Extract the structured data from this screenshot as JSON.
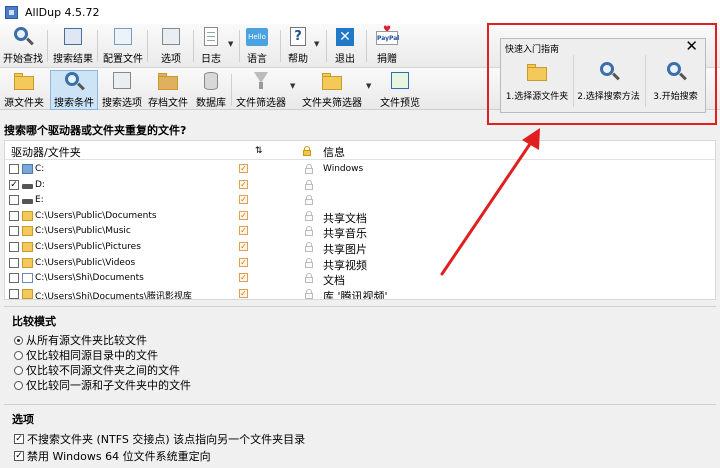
{
  "window": {
    "title": "AllDup 4.5.72"
  },
  "toolbar1": [
    {
      "label": "开始查找",
      "icon": "magnifier-icon"
    },
    {
      "label": "搜索结果",
      "icon": "results-icon"
    },
    {
      "label": "配置文件",
      "icon": "profile-icon"
    },
    {
      "label": "选项",
      "icon": "options-icon"
    },
    {
      "label": "日志",
      "icon": "log-icon"
    },
    {
      "label": "语言",
      "icon": "language-icon",
      "badge": "Hello"
    },
    {
      "label": "帮助",
      "icon": "help-icon",
      "badge": "?"
    },
    {
      "label": "退出",
      "icon": "exit-icon",
      "badge": "✕"
    },
    {
      "label": "捐赠",
      "icon": "donate-icon",
      "badge": "PayPal"
    }
  ],
  "toolbar2": [
    {
      "label": "源文件夹",
      "icon": "source-folder-icon"
    },
    {
      "label": "搜索条件",
      "icon": "search-criteria-icon"
    },
    {
      "label": "搜索选项",
      "icon": "search-options-icon"
    },
    {
      "label": "存档文件",
      "icon": "archive-icon"
    },
    {
      "label": "数据库",
      "icon": "database-icon"
    },
    {
      "label": "文件筛选器",
      "icon": "file-filter-icon"
    },
    {
      "label": "文件夹筛选器",
      "icon": "folder-filter-icon"
    },
    {
      "label": "文件预览",
      "icon": "file-preview-icon"
    }
  ],
  "quick_guide": {
    "title": "快速入门指南",
    "close": "✕",
    "steps": [
      "1.选择源文件夹",
      "2.选择搜索方法",
      "3.开始搜索"
    ]
  },
  "source": {
    "heading": "搜索哪个驱动器或文件夹重复的文件?",
    "columns": {
      "path": "驱动器/文件夹",
      "info": "信息"
    },
    "rows": [
      {
        "path": "C:",
        "checked": false,
        "info": "Windows",
        "kind": "sysdrive"
      },
      {
        "path": "D:",
        "checked": true,
        "info": "",
        "kind": "drive"
      },
      {
        "path": "E:",
        "checked": false,
        "info": "",
        "kind": "drive"
      },
      {
        "path": "C:\\Users\\Public\\Documents",
        "checked": false,
        "info": "共享文档",
        "kind": "folder"
      },
      {
        "path": "C:\\Users\\Public\\Music",
        "checked": false,
        "info": "共享音乐",
        "kind": "folder"
      },
      {
        "path": "C:\\Users\\Public\\Pictures",
        "checked": false,
        "info": "共享图片",
        "kind": "folder"
      },
      {
        "path": "C:\\Users\\Public\\Videos",
        "checked": false,
        "info": "共享视频",
        "kind": "folder"
      },
      {
        "path": "C:\\Users\\Shi\\Documents",
        "checked": false,
        "info": "文档",
        "kind": "doc"
      },
      {
        "path": "C:\\Users\\Shi\\Documents\\腾讯影视库",
        "checked": false,
        "info": "库 '腾讯视频'",
        "kind": "folder"
      }
    ]
  },
  "compare_mode": {
    "title": "比较模式",
    "options": [
      {
        "label": "从所有源文件夹比较文件",
        "selected": true
      },
      {
        "label": "仅比较相同源目录中的文件",
        "selected": false
      },
      {
        "label": "仅比较不同源文件夹之间的文件",
        "selected": false
      },
      {
        "label": "仅比较同一源和子文件夹中的文件",
        "selected": false
      }
    ]
  },
  "options": {
    "title": "选项",
    "items": [
      {
        "label": "不搜索文件夹 (NTFS 交接点) 该点指向另一个文件夹目录",
        "checked": true
      },
      {
        "label": "禁用 Windows 64 位文件系统重定向",
        "checked": true
      }
    ]
  },
  "colors": {
    "highlight": "#e02020",
    "active_tab": "#cde4f7",
    "folder": "#f5c85a"
  }
}
